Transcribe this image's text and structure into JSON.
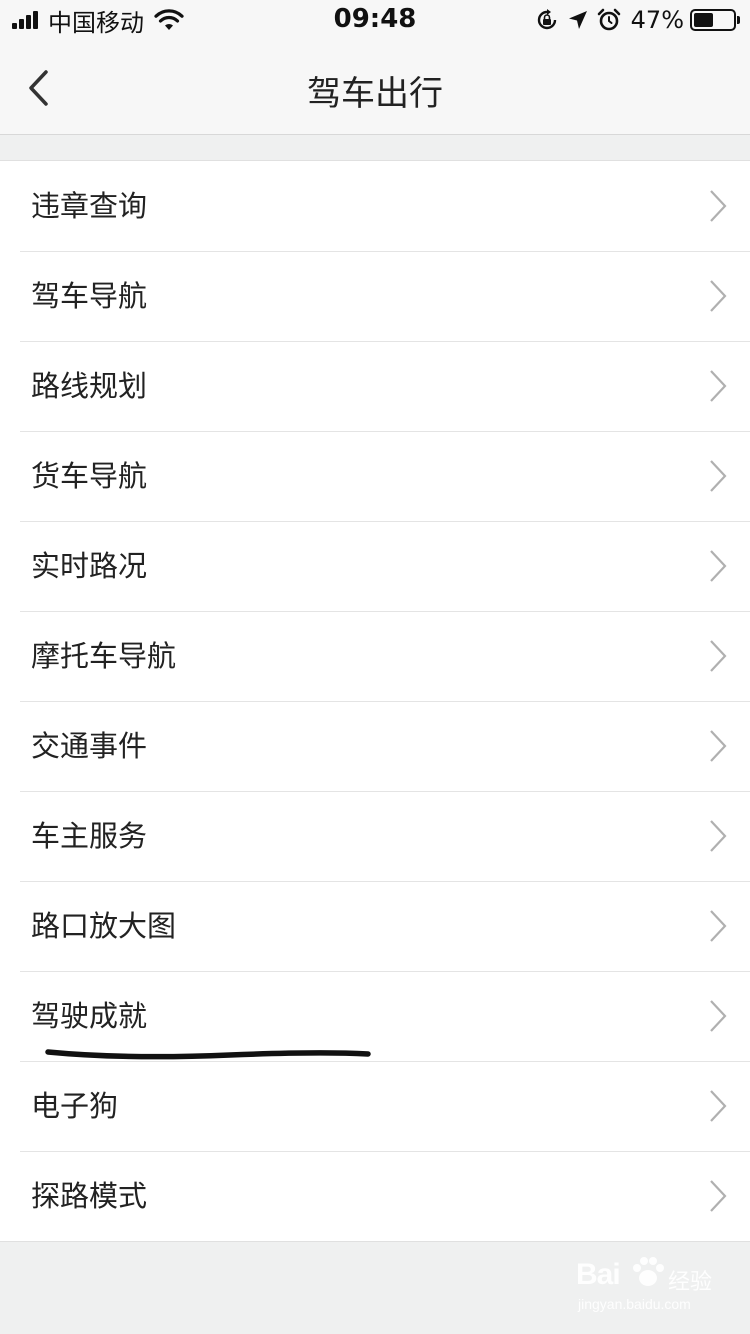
{
  "status_bar": {
    "carrier": "中国移动",
    "time": "09:48",
    "battery_percent": "47%",
    "battery_level": 0.47,
    "icons": [
      "signal-icon",
      "wifi-icon",
      "orientation-lock-icon",
      "location-icon",
      "alarm-icon",
      "battery-icon"
    ]
  },
  "nav": {
    "title": "驾车出行",
    "back_icon": "back-chevron-icon"
  },
  "menu": {
    "items": [
      {
        "label": "违章查询"
      },
      {
        "label": "驾车导航"
      },
      {
        "label": "路线规划"
      },
      {
        "label": "货车导航"
      },
      {
        "label": "实时路况"
      },
      {
        "label": "摩托车导航"
      },
      {
        "label": "交通事件"
      },
      {
        "label": "车主服务"
      },
      {
        "label": "路口放大图"
      },
      {
        "label": "驾驶成就"
      },
      {
        "label": "电子狗"
      },
      {
        "label": "探路模式"
      }
    ],
    "chevron_icon": "chevron-right-icon"
  },
  "watermark": {
    "brand": "Bai",
    "sub": "经验",
    "url": "jingyan.baidu.com"
  },
  "colors": {
    "background": "#eff0f0",
    "list_background": "#ffffff",
    "nav_background": "#f7f7f7",
    "divider": "#e4e4e4",
    "chevron": "#b0b0b0",
    "text": "#222222"
  }
}
